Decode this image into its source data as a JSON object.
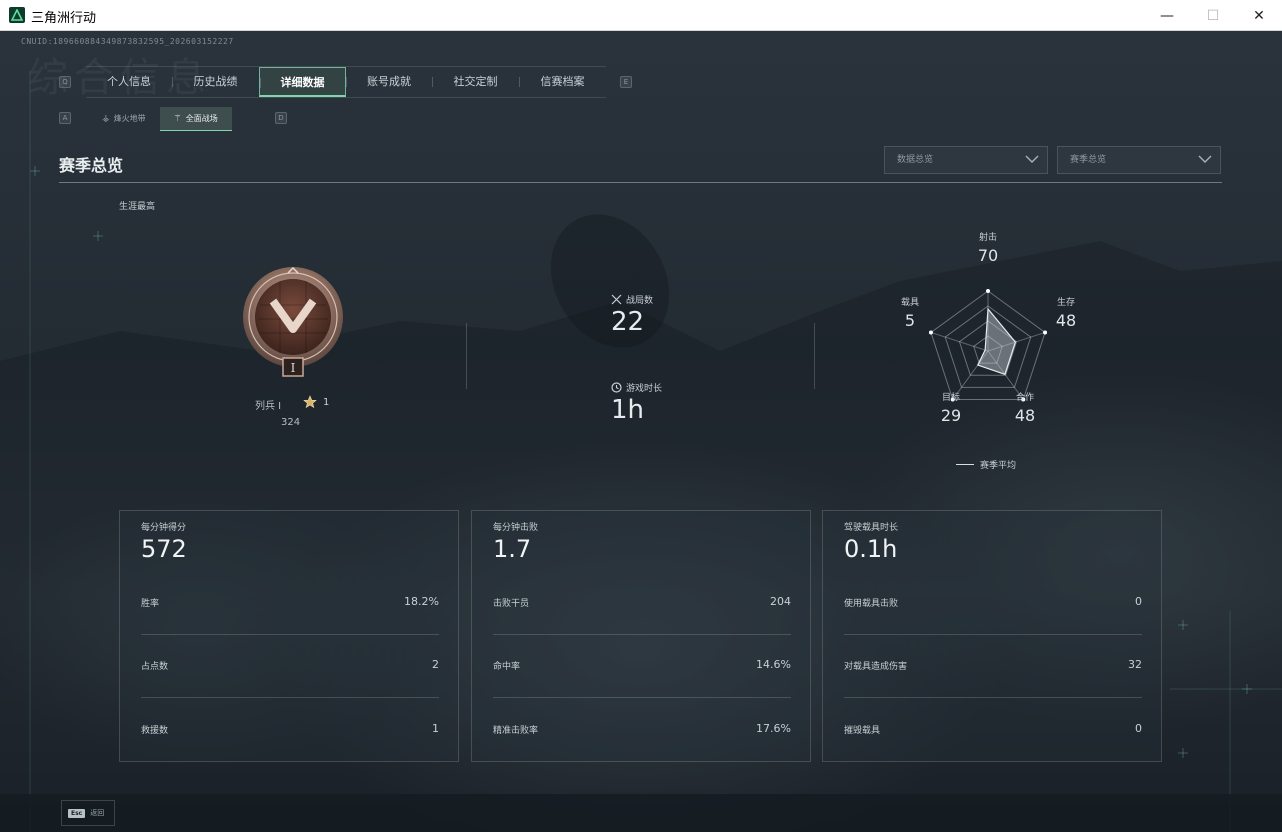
{
  "window": {
    "title": "三角洲行动",
    "minimize": "—",
    "maximize": "☐",
    "close": "✕"
  },
  "uid": "CNUID:1896608843498738325­95_202603152227",
  "ghost_title": "综合信息",
  "key_hints": {
    "prev_tab": "Q",
    "next_tab": "E",
    "prev_sub": "A",
    "next_sub": "D"
  },
  "main_tabs": [
    {
      "label": "个人信息",
      "active": false
    },
    {
      "label": "历史战绩",
      "active": false
    },
    {
      "label": "详细数据",
      "active": true
    },
    {
      "label": "账号成就",
      "active": false
    },
    {
      "label": "社交定制",
      "active": false
    },
    {
      "label": "信赛档案",
      "active": false
    }
  ],
  "sub_tabs": [
    {
      "label": "烽火地带",
      "icon": "fire-zone-icon",
      "active": false
    },
    {
      "label": "全面战场",
      "icon": "battlefield-icon",
      "active": true
    }
  ],
  "section": {
    "title": "赛季总览",
    "dropdown_1": "数据总览",
    "dropdown_2": "赛季总览",
    "career_label": "生涯最高"
  },
  "rank": {
    "name": "列兵 I",
    "stars": "1",
    "points": "324",
    "badge_numeral": "I"
  },
  "stats": {
    "matches_label": "战局数",
    "matches_value": "22",
    "playtime_label": "游戏时长",
    "playtime_value": "1h"
  },
  "radar": {
    "axes": [
      {
        "label": "射击",
        "value": "70",
        "score": 70
      },
      {
        "label": "生存",
        "value": "48",
        "score": 48
      },
      {
        "label": "合作",
        "value": "48",
        "score": 48
      },
      {
        "label": "目标",
        "value": "29",
        "score": 29
      },
      {
        "label": "载具",
        "value": "5",
        "score": 5
      }
    ],
    "legend": "赛季平均"
  },
  "cards": [
    {
      "head_label": "每分钟得分",
      "head_value": "572",
      "rows": [
        {
          "label": "胜率",
          "value": "18.2%"
        },
        {
          "label": "占点数",
          "value": "2"
        },
        {
          "label": "救援数",
          "value": "1"
        }
      ]
    },
    {
      "head_label": "每分钟击败",
      "head_value": "1.7",
      "rows": [
        {
          "label": "击败干员",
          "value": "204"
        },
        {
          "label": "命中率",
          "value": "14.6%"
        },
        {
          "label": "精准击败率",
          "value": "17.6%"
        }
      ]
    },
    {
      "head_label": "驾驶载具时长",
      "head_value": "0.1h",
      "rows": [
        {
          "label": "使用载具击败",
          "value": "0"
        },
        {
          "label": "对载具造成伤害",
          "value": "32"
        },
        {
          "label": "摧毁载具",
          "value": "0"
        }
      ]
    }
  ],
  "bottom": {
    "esc_key": "Esc",
    "esc_label": "返回"
  },
  "colors": {
    "accent": "#7fd6ad",
    "text": "#c8d0d4",
    "bg": "#1b222a"
  }
}
